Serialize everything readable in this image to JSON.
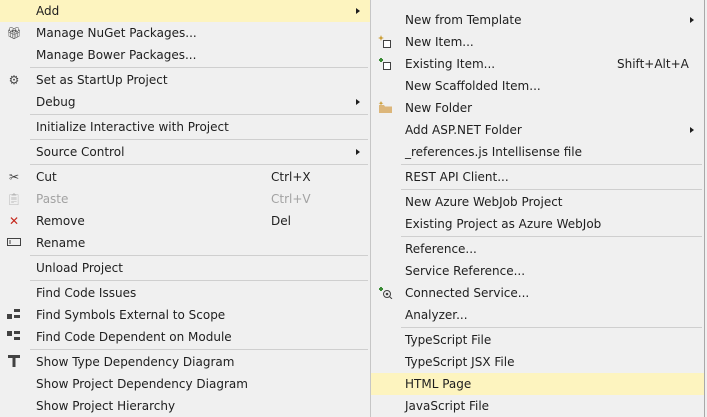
{
  "left_menu": {
    "add": "Add",
    "manage_nuget": "Manage NuGet Packages...",
    "manage_bower": "Manage Bower Packages...",
    "set_startup": "Set as StartUp Project",
    "debug": "Debug",
    "init_interactive": "Initialize Interactive with Project",
    "source_control": "Source Control",
    "cut": "Cut",
    "cut_shortcut": "Ctrl+X",
    "paste": "Paste",
    "paste_shortcut": "Ctrl+V",
    "remove": "Remove",
    "remove_shortcut": "Del",
    "rename": "Rename",
    "unload": "Unload Project",
    "find_code_issues": "Find Code Issues",
    "find_symbols_external": "Find Symbols External to Scope",
    "find_code_dependent": "Find Code Dependent on Module",
    "show_type_dependency": "Show Type Dependency Diagram",
    "show_project_dependency": "Show Project Dependency Diagram",
    "show_project_hierarchy": "Show Project Hierarchy"
  },
  "right_menu": {
    "new_from_template": "New from Template",
    "new_item": "New Item...",
    "existing_item": "Existing Item...",
    "existing_item_shortcut": "Shift+Alt+A",
    "new_scaffolded": "New Scaffolded Item...",
    "new_folder": "New Folder",
    "add_aspnet_folder": "Add ASP.NET Folder",
    "references_js": "_references.js Intellisense file",
    "rest_api_client": "REST API Client...",
    "new_azure_webjob": "New Azure WebJob Project",
    "existing_azure_webjob": "Existing Project as Azure WebJob",
    "reference": "Reference...",
    "service_reference": "Service Reference...",
    "connected_service": "Connected Service...",
    "analyzer": "Analyzer...",
    "typescript_file": "TypeScript File",
    "typescript_jsx_file": "TypeScript JSX File",
    "html_page": "HTML Page",
    "javascript_file": "JavaScript File"
  },
  "colors": {
    "menu_bg": "#f0f0f0",
    "highlight": "#fdf4bf",
    "disabled_text": "#a2a2a2",
    "separator": "#cfcfcf"
  },
  "icons": {
    "nuget": "gift-icon",
    "startup": "gear-icon",
    "cut": "scissors-icon",
    "paste": "clipboard-icon",
    "remove": "red-x-icon",
    "rename": "rename-icon",
    "find_symbols_external": "dependency-icon",
    "find_code_dependent": "dependency-icon",
    "show_type_dependency": "type-dependency-icon",
    "new_item": "new-item-icon",
    "existing_item": "existing-item-icon",
    "new_folder": "new-folder-icon",
    "connected_service": "connected-service-icon"
  }
}
